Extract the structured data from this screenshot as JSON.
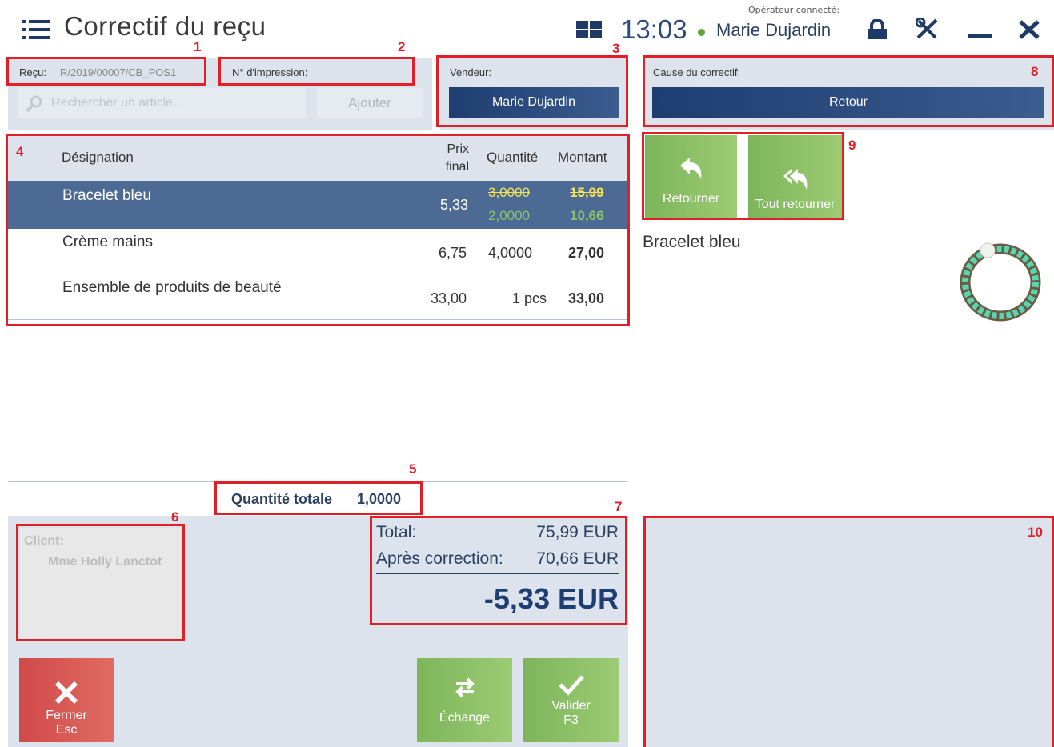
{
  "header": {
    "title": "Correctif du reçu",
    "clock": "13:03",
    "operator_label": "Opérateur connecté:",
    "operator_name": "Marie Dujardin"
  },
  "receipt": {
    "label": "Reçu:",
    "value": "R/2019/00007/CB_POS1",
    "print_label": "N° d'impression:",
    "search_placeholder": "Rechercher un article...",
    "add_button": "Ajouter"
  },
  "seller": {
    "label": "Vendeur:",
    "value": "Marie Dujardin"
  },
  "cause": {
    "label": "Cause du correctif:",
    "value": "Retour"
  },
  "table": {
    "headers": {
      "name": "Désignation",
      "price": "Prix\nfinal",
      "qty": "Quantité",
      "amount": "Montant"
    },
    "rows": [
      {
        "name": "Bracelet bleu",
        "price": "5,33",
        "qty_old": "3,0000",
        "qty_new": "2,0000",
        "amount_old": "15,99",
        "amount_new": "10,66"
      },
      {
        "name": "Crème mains",
        "price": "6,75",
        "qty": "4,0000",
        "amount": "27,00"
      },
      {
        "name": "Ensemble de produits de beauté",
        "price": "33,00",
        "qty": "1 pcs",
        "amount": "33,00"
      }
    ]
  },
  "total_qty": {
    "label": "Quantité totale",
    "value": "1,0000"
  },
  "client": {
    "label": "Client:",
    "name": "Mme Holly Lanctot"
  },
  "totals": {
    "total_label": "Total:",
    "total_value": "75,99 EUR",
    "after_label": "Après correction:",
    "after_value": "70,66 EUR",
    "diff": "-5,33 EUR"
  },
  "actions": {
    "return": "Retourner",
    "return_all": "Tout retourner",
    "close": "Fermer",
    "close_key": "Esc",
    "exchange": "Échange",
    "validate": "Valider",
    "validate_key": "F3"
  },
  "preview": {
    "product_name": "Bracelet bleu"
  },
  "markers": [
    "1",
    "2",
    "3",
    "4",
    "5",
    "6",
    "7",
    "8",
    "9",
    "10"
  ],
  "colors": {
    "accent": "#1e3d70",
    "green": "#7db55b",
    "red_button": "#d9534f",
    "panel": "#dce3ec",
    "selected_row": "#4d6a95",
    "marker": "#e01f26"
  }
}
